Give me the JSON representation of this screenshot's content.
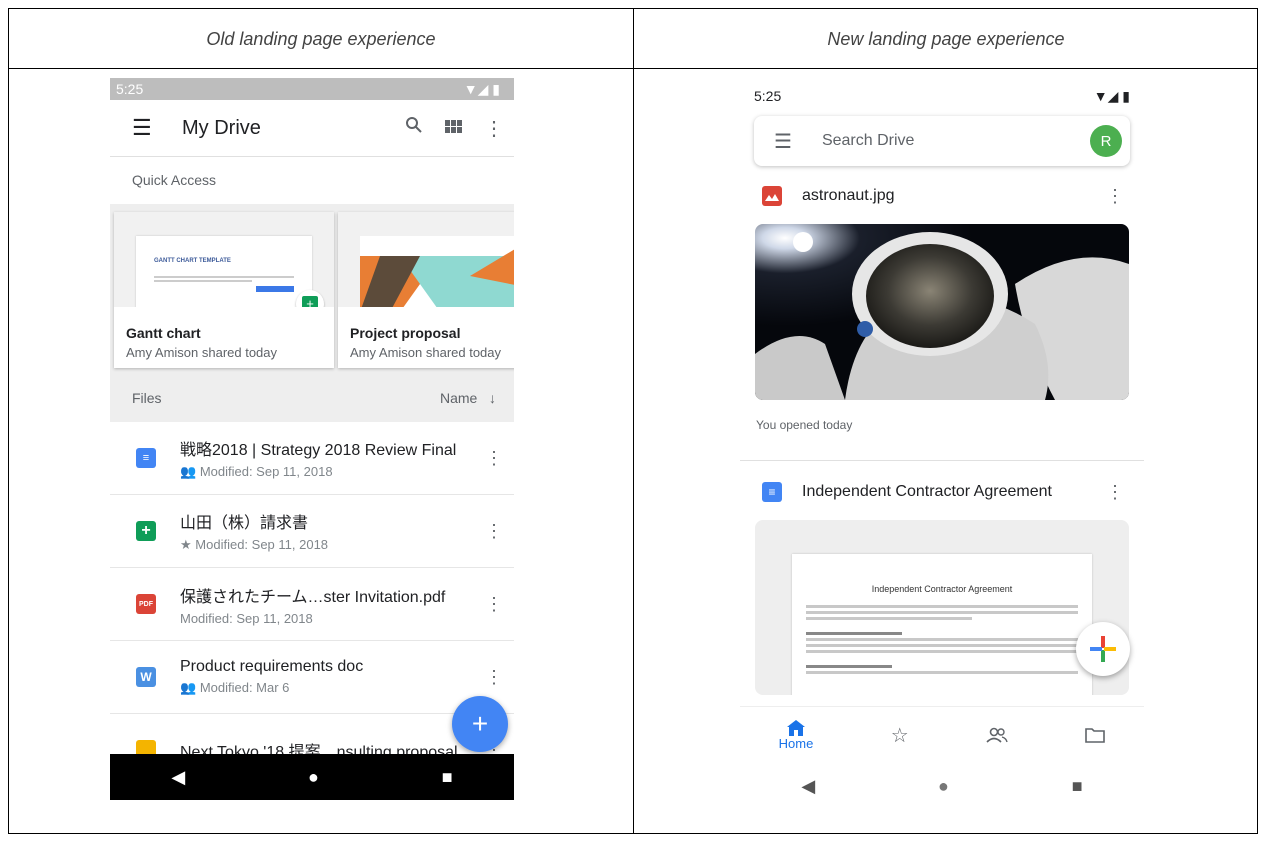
{
  "headers": {
    "old": "Old landing page experience",
    "new": "New landing page experience"
  },
  "old": {
    "status_time": "5:25",
    "app_title": "My Drive",
    "quick_access_label": "Quick Access",
    "cards": [
      {
        "name": "Gantt chart",
        "sub": "Amy Amison shared today",
        "thumb_text": "GANTT CHART TEMPLATE"
      },
      {
        "name": "Project proposal",
        "sub": "Amy Amison shared today"
      }
    ],
    "files_label": "Files",
    "sort_label": "Name",
    "files": [
      {
        "title": "戦略2018 | Strategy 2018 Review Final",
        "sub": "Modified: Sep 11, 2018",
        "icon": "docs-icon",
        "color": "#4285f4",
        "meta_icon": "shared-icon"
      },
      {
        "title": "山田（株）請求書",
        "sub": "Modified: Sep 11, 2018",
        "icon": "sheets-icon",
        "color": "#0f9d58",
        "meta_icon": "star-icon"
      },
      {
        "title": "保護されたチーム…ster Invitation.pdf",
        "sub": "Modified: Sep 11, 2018",
        "icon": "pdf-icon",
        "color": "#db4437",
        "icon_text": "PDF"
      },
      {
        "title": "Product requirements doc",
        "sub": "Modified: Mar 6",
        "icon": "word-icon",
        "color": "#4a90e2",
        "icon_text": "W",
        "meta_icon": "shared-icon"
      },
      {
        "title": "Next Tokyo '18 提案…nsulting proposal",
        "sub": "",
        "icon": "slides-icon",
        "color": "#f4b400"
      }
    ]
  },
  "new": {
    "status_time": "5:25",
    "search_placeholder": "Search Drive",
    "avatar_letter": "R",
    "items": [
      {
        "name": "astronaut.jpg",
        "caption": "You opened today",
        "icon": "image-icon",
        "color": "#db4437"
      },
      {
        "name": "Independent Contractor Agreement",
        "icon": "docs-icon",
        "color": "#4285f4",
        "doc_title": "Independent Contractor Agreement"
      }
    ],
    "bottom_nav": [
      {
        "label": "Home",
        "icon": "home-icon"
      },
      {
        "label": "",
        "icon": "star-icon"
      },
      {
        "label": "",
        "icon": "shared-icon"
      },
      {
        "label": "",
        "icon": "folder-icon"
      }
    ]
  }
}
